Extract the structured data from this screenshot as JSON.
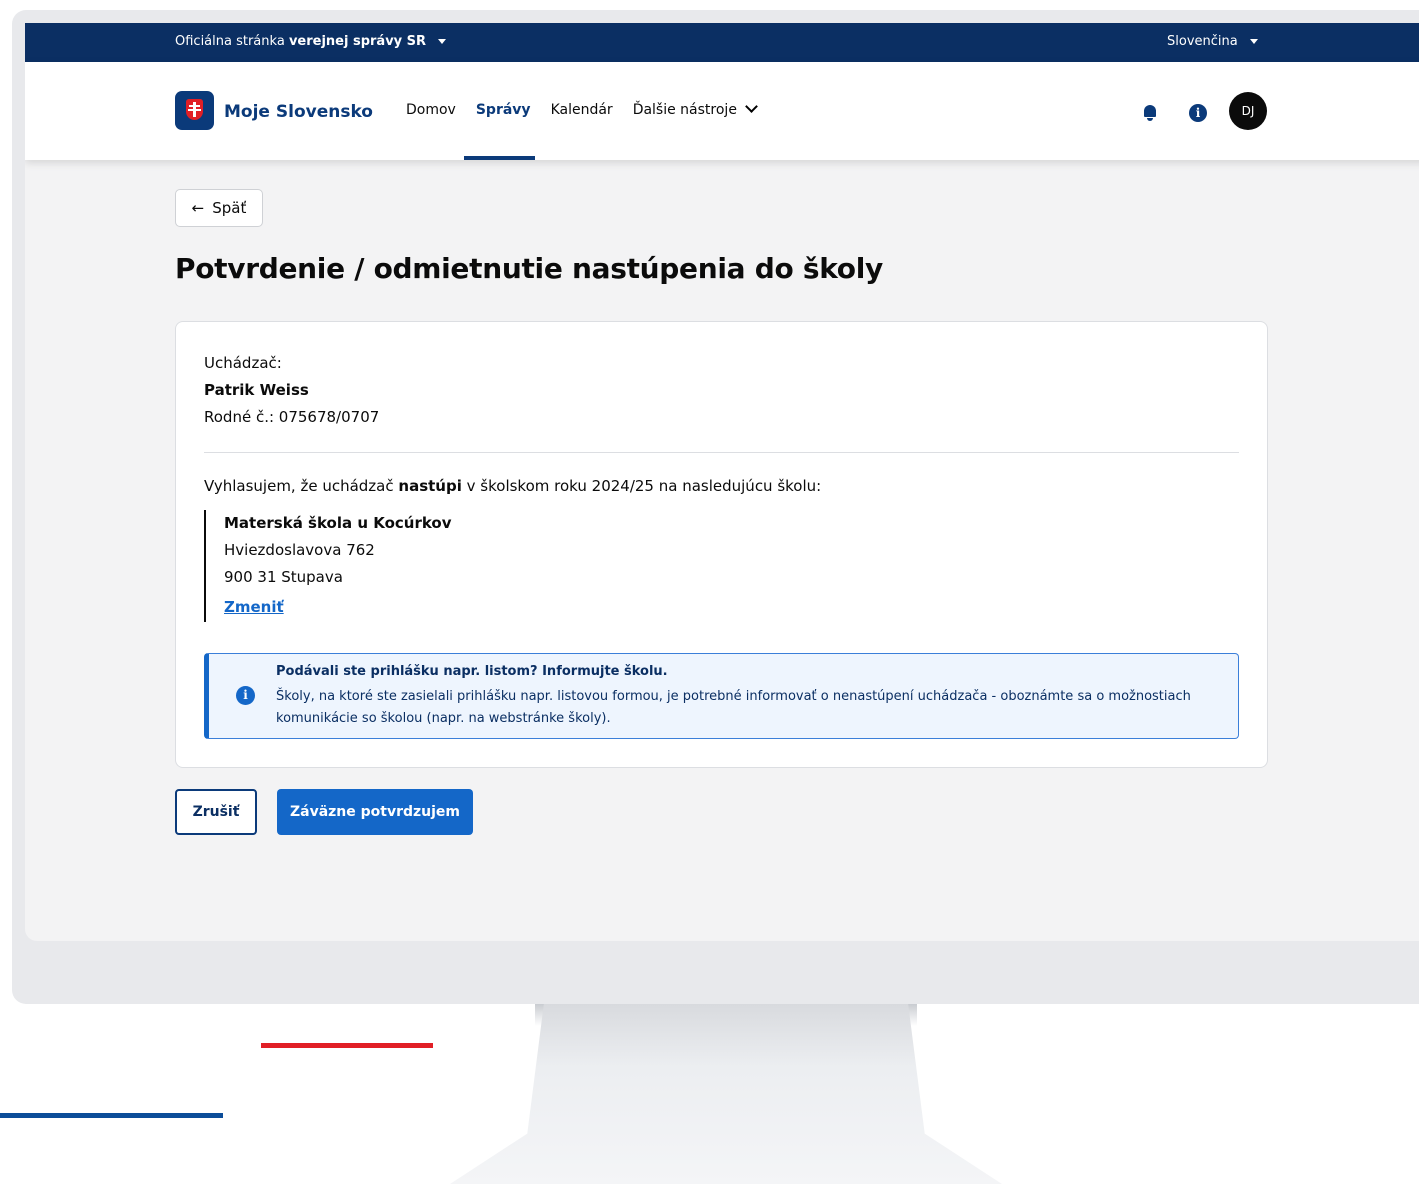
{
  "gov_bar": {
    "prefix": "Oficiálna stránka",
    "bold": "verejnej správy SR",
    "language": "Slovenčina"
  },
  "header": {
    "brand": "Moje Slovensko",
    "nav": [
      "Domov",
      "Správy",
      "Kalendár",
      "Ďalšie nástroje"
    ],
    "active_nav": "Správy",
    "avatar_initials": "DJ"
  },
  "back_label": "Späť",
  "page_title": "Potvrdenie / odmietnutie nastúpenia do školy",
  "applicant": {
    "label": "Uchádzač:",
    "name": "Patrik Weiss",
    "birth_number": "Rodné č.: 075678/0707"
  },
  "declaration": {
    "before": "Vyhlasujem, že uchádzač",
    "bold": "nastúpi",
    "after": "v školskom roku 2024/25 na nasledujúcu školu:"
  },
  "school": {
    "name": "Materská škola u Kocúrkov",
    "street": "Hviezdoslavova 762",
    "city": "900 31 Stupava",
    "change_link": "Zmeniť"
  },
  "alert": {
    "title": "Podávali ste prihlášku napr. listom? Informujte školu.",
    "text": "Školy, na ktoré ste zasielali prihlášku napr. listovou formou, je potrebné informovať o nenastúpení uchádzača - oboznámte sa o možnostiach komunikácie so školou (napr. na webstránke školy)."
  },
  "actions": {
    "cancel": "Zrušiť",
    "confirm": "Záväzne potvrdzujem"
  },
  "colors": {
    "navy": "#0b2f63",
    "primary_blue": "#1467c8",
    "red": "#e11f26"
  }
}
